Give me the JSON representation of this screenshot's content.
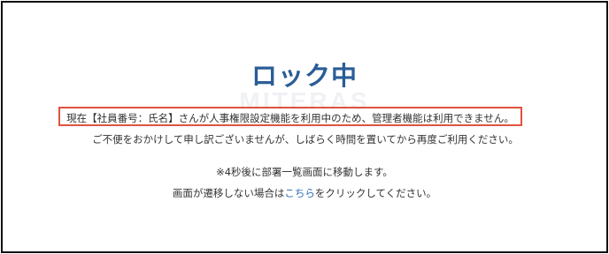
{
  "watermark": "MITERAS",
  "title": "ロック中",
  "message": {
    "line1": "現在【社員番号：氏名】さんが人事権限設定機能を利用中のため、管理者機能は利用できません。",
    "line2": "ご不便をおかけして申し訳ございませんが、しばらく時間を置いてから再度ご利用ください。",
    "line3": "※4秒後に部署一覧画面に移動します。",
    "line4_before": "画面が遷移しない場合は",
    "line4_link": "こちら",
    "line4_after": "をクリックしてください。"
  },
  "colors": {
    "title": "#2a5d96",
    "highlight_border": "#e0533f",
    "link": "#2f6fb0"
  }
}
